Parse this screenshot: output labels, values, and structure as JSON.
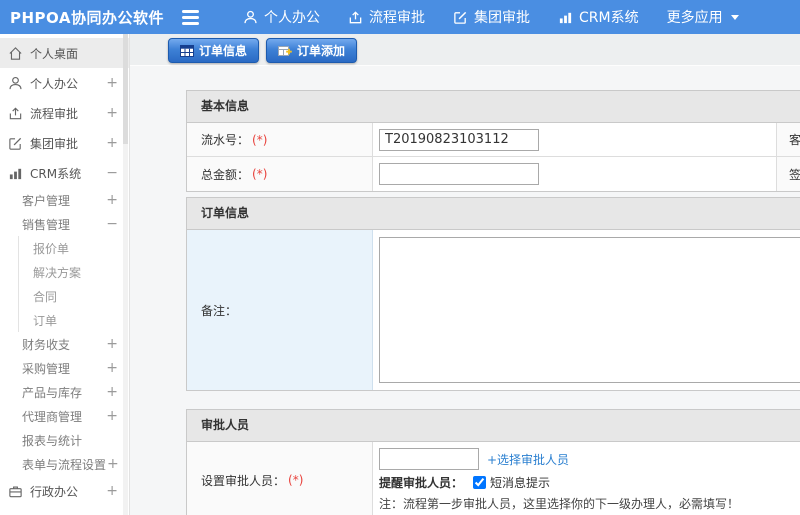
{
  "colors": {
    "accent": "#4a8ee2",
    "tab_border": "#1d5bae",
    "link": "#2a7fd0",
    "required": "#e8423c"
  },
  "header": {
    "logo": "PHPOA协同办公软件",
    "nav": [
      {
        "label": "个人办公",
        "icon": "person-icon"
      },
      {
        "label": "流程审批",
        "icon": "flow-icon"
      },
      {
        "label": "集团审批",
        "icon": "edit-icon"
      },
      {
        "label": "CRM系统",
        "icon": "chart-icon"
      },
      {
        "label": "更多应用",
        "icon": "caret-down-icon"
      }
    ]
  },
  "sidebar": {
    "items": [
      {
        "label": "个人桌面",
        "icon": "home-icon",
        "expander": "",
        "active": true
      },
      {
        "label": "个人办公",
        "icon": "person-icon",
        "expander": "+"
      },
      {
        "label": "流程审批",
        "icon": "flow-icon",
        "expander": "+"
      },
      {
        "label": "集团审批",
        "icon": "edit-icon",
        "expander": "+"
      },
      {
        "label": "CRM系统",
        "icon": "chart-icon",
        "expander": "−"
      },
      {
        "label": "客户管理",
        "expander": "+"
      },
      {
        "label": "销售管理",
        "expander": "−"
      },
      {
        "label": "报价单",
        "expander": ""
      },
      {
        "label": "解决方案",
        "expander": ""
      },
      {
        "label": "合同",
        "expander": ""
      },
      {
        "label": "订单",
        "expander": ""
      },
      {
        "label": "财务收支",
        "expander": "+"
      },
      {
        "label": "采购管理",
        "expander": "+"
      },
      {
        "label": "产品与库存",
        "expander": "+"
      },
      {
        "label": "代理商管理",
        "expander": "+"
      },
      {
        "label": "报表与统计",
        "expander": ""
      },
      {
        "label": "表单与流程设置",
        "expander": "+"
      },
      {
        "label": "行政办公",
        "icon": "briefcase-icon",
        "expander": "+"
      }
    ]
  },
  "tabbar": {
    "tabs": [
      {
        "label": "订单信息",
        "icon": "table-icon"
      },
      {
        "label": "订单添加",
        "icon": "table-add-icon"
      }
    ]
  },
  "form": {
    "basic": {
      "title": "基本信息",
      "rows": [
        {
          "label": "流水号：",
          "required": "(*)",
          "value": "T20190823103112",
          "right_label": "客"
        },
        {
          "label": "总金额：",
          "required": "(*)",
          "value": "",
          "right_label": "签"
        }
      ]
    },
    "order": {
      "title": "订单信息",
      "note_label": "备注："
    },
    "approver": {
      "title": "审批人员",
      "label": "设置审批人员：",
      "required": "(*)",
      "input_value": "",
      "select_link": "+选择审批人员",
      "remind_label": "提醒审批人员：",
      "sms_label": "短消息提示",
      "note": "注：流程第一步审批人员，这里选择你的下一级办理人，必需填写！"
    }
  }
}
